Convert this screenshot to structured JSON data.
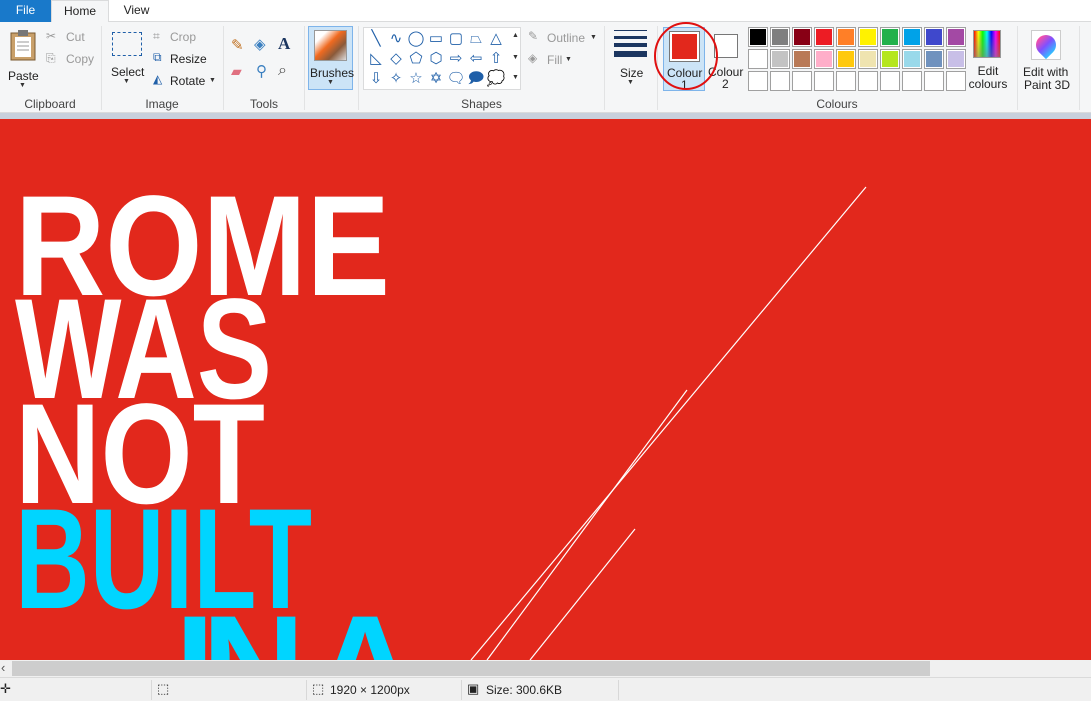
{
  "tabs": [
    {
      "label": "File"
    },
    {
      "label": "Home"
    },
    {
      "label": "View"
    }
  ],
  "clipboard": {
    "paste": "Paste",
    "cut": "Cut",
    "copy": "Copy",
    "group": "Clipboard"
  },
  "image": {
    "select": "Select",
    "crop": "Crop",
    "resize": "Resize",
    "rotate": "Rotate",
    "group": "Image"
  },
  "tools": {
    "group": "Tools",
    "items": [
      "pencil-icon",
      "fill-icon",
      "text-icon",
      "eraser-icon",
      "color-picker-icon",
      "magnifier-icon"
    ]
  },
  "brushes": {
    "label": "Brushes"
  },
  "shapes": {
    "group": "Shapes",
    "outline": "Outline",
    "fill": "Fill",
    "glyphs": [
      "╲",
      "∿",
      "◯",
      "▭",
      "▢",
      "⏢",
      "△",
      "◺",
      "◇",
      "⬠",
      "⬡",
      "⇨",
      "⇦",
      "⇧",
      "⇩",
      "✧",
      "☆",
      "✡",
      "🗨",
      "🗩",
      "💭"
    ]
  },
  "size": {
    "label": "Size"
  },
  "colours": {
    "group": "Colours",
    "colour1": "Colour",
    "colour1_num": "1",
    "colour2": "Colour",
    "colour2_num": "2",
    "colour1_value": "#e2281c",
    "colour2_value": "#ffffff",
    "palette_row1": [
      "#000000",
      "#7f7f7f",
      "#880015",
      "#ed1c24",
      "#ff7f27",
      "#fff200",
      "#22b14c",
      "#00a2e8",
      "#3f48cc",
      "#a349a4"
    ],
    "palette_row2": [
      "#ffffff",
      "#c3c3c3",
      "#b97a57",
      "#ffaec9",
      "#ffc90e",
      "#efe4b0",
      "#b5e61d",
      "#99d9ea",
      "#7092be",
      "#c8bfe7"
    ],
    "edit": "Edit colours"
  },
  "paint3d": {
    "label1": "Edit with",
    "label2": "Paint 3D"
  },
  "canvas": {
    "background": "#e2281c",
    "lines": [
      "ROME",
      "WAS",
      "NOT",
      "BUILT",
      "IN A"
    ],
    "white": "#ffffff",
    "cyan": "#00d5ff"
  },
  "status": {
    "dimensions": "1920 × 1200px",
    "size": "Size: 300.6KB"
  }
}
